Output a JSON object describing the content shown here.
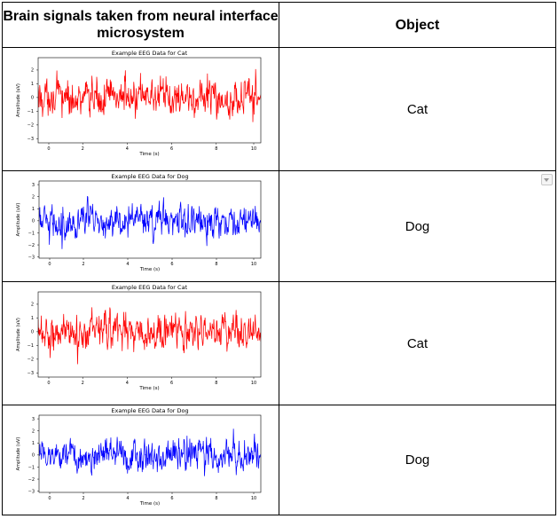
{
  "table": {
    "header": {
      "col1": "Brain signals taken from neural interface microsystem",
      "col2": "Object"
    },
    "rows": [
      {
        "object": "Cat",
        "plot": {
          "title": "Example EEG Data for Cat",
          "xlabel": "Time (s)",
          "ylabel": "Amplitude (uV)",
          "color": "#ff0000",
          "xticks": [
            "0",
            "2",
            "4",
            "6",
            "8",
            "10"
          ],
          "yticks": [
            "2",
            "1",
            "0",
            "−1",
            "−2",
            "−3"
          ]
        }
      },
      {
        "object": "Dog",
        "plot": {
          "title": "Example EEG Data for Dog",
          "xlabel": "Time (s)",
          "ylabel": "Amplitude (uV)",
          "color": "#0000ff",
          "xticks": [
            "0",
            "2",
            "4",
            "6",
            "8",
            "10"
          ],
          "yticks": [
            "3",
            "2",
            "1",
            "0",
            "−1",
            "−2",
            "−3"
          ]
        }
      },
      {
        "object": "Cat",
        "plot": {
          "title": "Example EEG Data for Cat",
          "xlabel": "Time (s)",
          "ylabel": "Amplitude (uV)",
          "color": "#ff0000",
          "xticks": [
            "0",
            "2",
            "4",
            "6",
            "8",
            "10"
          ],
          "yticks": [
            "2",
            "1",
            "0",
            "−1",
            "−2",
            "−3"
          ]
        }
      },
      {
        "object": "Dog",
        "plot": {
          "title": "Example EEG Data for Dog",
          "xlabel": "Time (s)",
          "ylabel": "Amplitude (uV)",
          "color": "#0000ff",
          "xticks": [
            "0",
            "2",
            "4",
            "6",
            "8",
            "10"
          ],
          "yticks": [
            "3",
            "2",
            "1",
            "0",
            "−1",
            "−2",
            "−3"
          ]
        }
      }
    ]
  },
  "chart_data": [
    {
      "type": "line",
      "title": "Example EEG Data for Cat",
      "xlabel": "Time (s)",
      "ylabel": "Amplitude (uV)",
      "xlim": [
        0,
        10
      ],
      "ylim": [
        -3.3,
        2.9
      ],
      "series": [
        {
          "color": "#ff0000",
          "values": []
        }
      ]
    },
    {
      "type": "line",
      "title": "Example EEG Data for Dog",
      "xlabel": "Time (s)",
      "ylabel": "Amplitude (uV)",
      "xlim": [
        0,
        10
      ],
      "ylim": [
        -3.1,
        3.3
      ],
      "series": [
        {
          "color": "#0000ff",
          "values": []
        }
      ]
    },
    {
      "type": "line",
      "title": "Example EEG Data for Cat",
      "xlabel": "Time (s)",
      "ylabel": "Amplitude (uV)",
      "xlim": [
        0,
        10
      ],
      "ylim": [
        -3.3,
        2.9
      ],
      "series": [
        {
          "color": "#ff0000",
          "values": []
        }
      ]
    },
    {
      "type": "line",
      "title": "Example EEG Data for Dog",
      "xlabel": "Time (s)",
      "ylabel": "Amplitude (uV)",
      "xlim": [
        0,
        10
      ],
      "ylim": [
        -3.1,
        3.3
      ],
      "series": [
        {
          "color": "#0000ff",
          "values": []
        }
      ]
    }
  ]
}
